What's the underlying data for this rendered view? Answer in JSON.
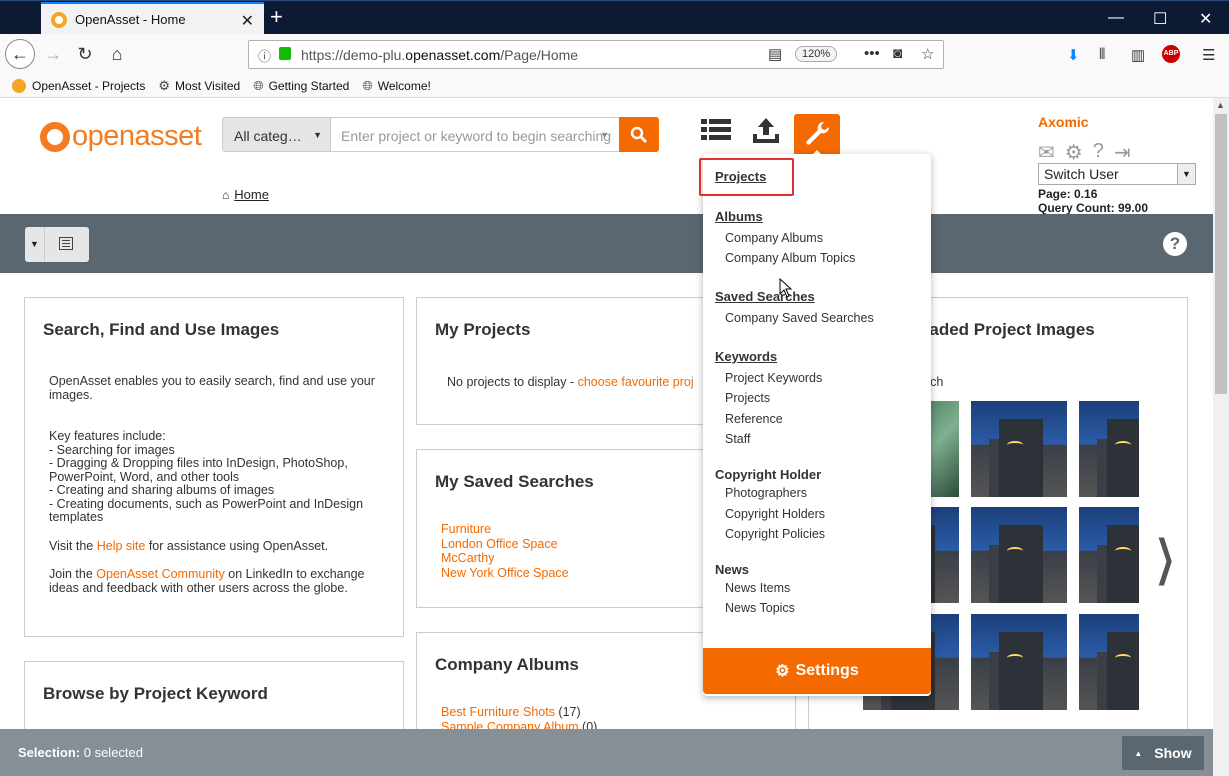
{
  "browser": {
    "tab_title": "OpenAsset - Home",
    "url_prefix": "https://demo-plu.",
    "url_domain": "openasset.com",
    "url_path": "/Page/Home",
    "zoom": "120%",
    "bookmarks": [
      "OpenAsset - Projects",
      "Most Visited",
      "Getting Started",
      "Welcome!"
    ]
  },
  "header": {
    "logo_text": "openasset",
    "category_select": "All categ…",
    "search_placeholder": "Enter project or keyword to begin searching",
    "breadcrumb_home": "Home"
  },
  "user": {
    "name": "Axomic",
    "switch_user": "Switch User",
    "page_time": "Page: 0.16",
    "query_count": "Query Count: 99.00"
  },
  "panels": {
    "search_find": {
      "title": "Search, Find and Use Images",
      "intro": "OpenAsset enables you to easily search, find and use your images.",
      "features_heading": "Key features include:",
      "features": [
        "- Searching for images",
        "- Dragging & Dropping files into InDesign, PhotoShop, PowerPoint, Word, and other tools",
        "- Creating and sharing albums of images",
        "- Creating documents, such as PowerPoint and InDesign templates"
      ],
      "visit_pre": "Visit the ",
      "visit_link": "Help site",
      "visit_post": " for assistance using OpenAsset.",
      "join_pre": "Join the ",
      "join_link": "OpenAsset Community",
      "join_post": " on LinkedIn to exchange ideas and feedback with other users across the globe."
    },
    "browse_keyword": {
      "title": "Browse by Project Keyword"
    },
    "my_projects": {
      "title": "My Projects",
      "msg_pre": "No projects to display - ",
      "msg_link": "choose favourite proj"
    },
    "saved_searches": {
      "title": "My Saved Searches",
      "items": [
        "Furniture",
        "London Office Space",
        "McCarthy",
        "New York Office Space"
      ]
    },
    "company_albums": {
      "title": "Company Albums",
      "items": [
        {
          "name": "Best Furniture Shots",
          "count": " (17)"
        },
        {
          "name": "Sample Company Album",
          "count": " (0)"
        }
      ]
    },
    "uploaded_images": {
      "title": "oaded Project Images",
      "sub": "arch"
    }
  },
  "menu": {
    "projects": "Projects",
    "albums": "Albums",
    "company_albums": "Company Albums",
    "company_album_topics": "Company Album Topics",
    "saved_searches": "Saved Searches",
    "company_saved_searches": "Company Saved Searches",
    "keywords": "Keywords",
    "project_keywords": "Project Keywords",
    "kw_projects": "Projects",
    "reference": "Reference",
    "staff": "Staff",
    "copyright_holder": "Copyright Holder",
    "photographers": "Photographers",
    "copyright_holders": "Copyright Holders",
    "copyright_policies": "Copyright Policies",
    "news": "News",
    "news_items": "News Items",
    "news_topics": "News Topics",
    "settings": "Settings"
  },
  "footer": {
    "selection_label": "Selection:",
    "selection_value": " 0 selected",
    "show": "Show"
  },
  "colors": {
    "accent": "#f46a00",
    "bar": "#5b6770"
  }
}
